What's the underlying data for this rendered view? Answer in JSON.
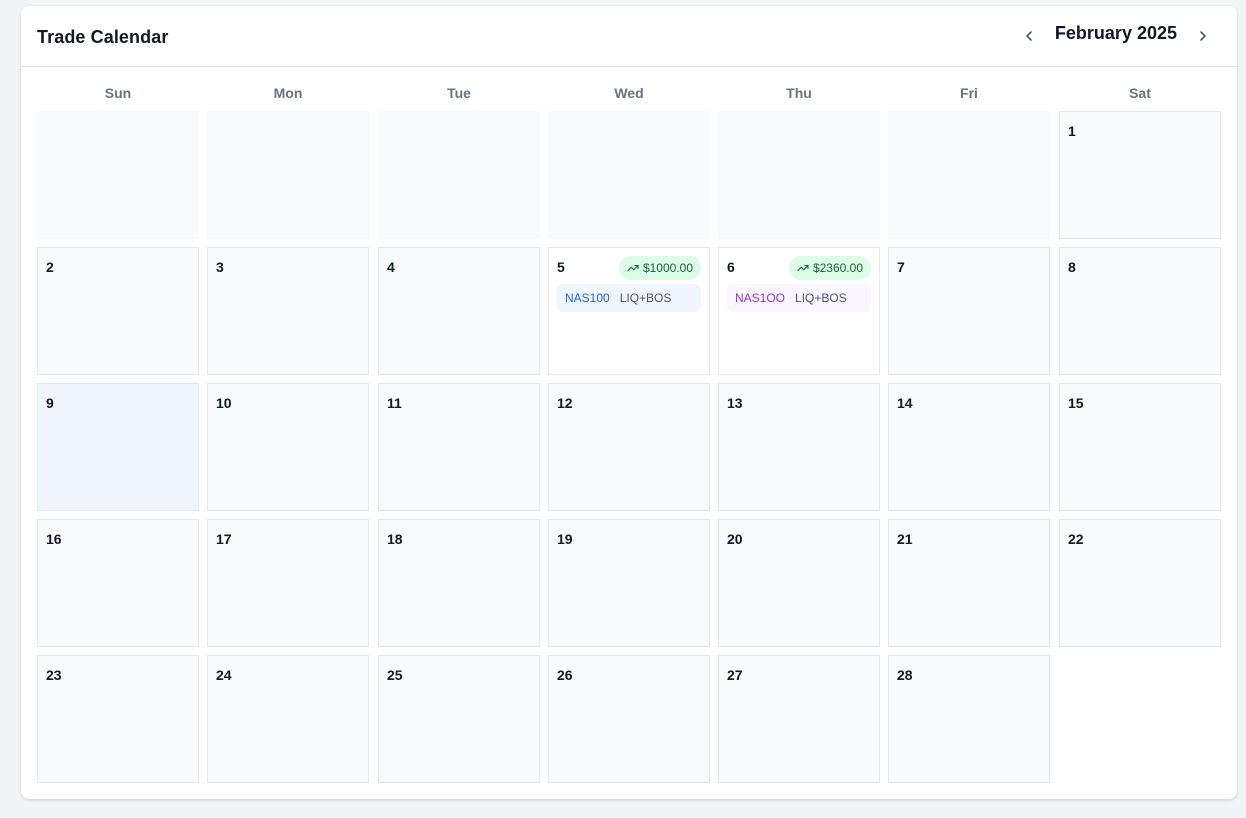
{
  "header": {
    "title": "Trade Calendar",
    "month_label": "February 2025",
    "prev_icon": "chevron-left-icon",
    "next_icon": "chevron-right-icon"
  },
  "weekdays": [
    "Sun",
    "Mon",
    "Tue",
    "Wed",
    "Thu",
    "Fri",
    "Sat"
  ],
  "days": [
    "1",
    "2",
    "3",
    "4",
    "5",
    "6",
    "7",
    "8",
    "9",
    "10",
    "11",
    "12",
    "13",
    "14",
    "15",
    "16",
    "17",
    "18",
    "19",
    "20",
    "21",
    "22",
    "23",
    "24",
    "25",
    "26",
    "27",
    "28"
  ],
  "trades": {
    "day5": {
      "pnl": "$1000.00",
      "symbol": "NAS100",
      "setup": "LIQ+BOS"
    },
    "day6": {
      "pnl": "$2360.00",
      "symbol": "NAS1OO",
      "setup": "LIQ+BOS"
    }
  },
  "colors": {
    "profit_bg": "#dcfce7",
    "profit_text": "#166534",
    "today_bg": "#eff6ff",
    "symbol_blue": "#2563eb",
    "symbol_purple": "#9333ea"
  }
}
